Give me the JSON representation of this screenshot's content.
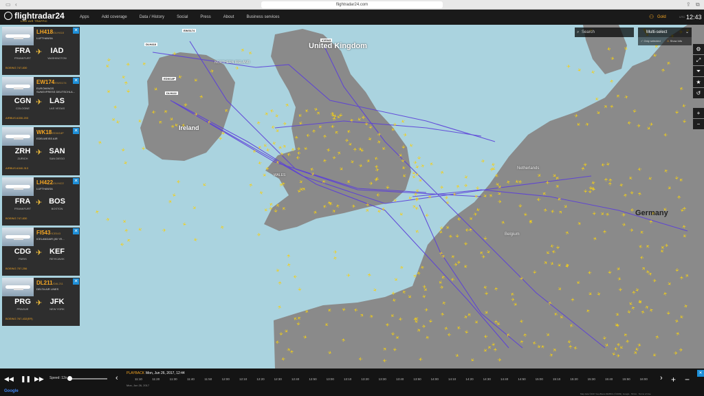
{
  "browser": {
    "url": "flightradar24.com"
  },
  "nav": {
    "logo": "flightradar24",
    "logo_sub": "LIVE AIR TRAFFIC",
    "items": [
      "Apps",
      "Add coverage",
      "Data / History",
      "Social",
      "Press",
      "About",
      "Business services"
    ],
    "account": "Gold",
    "utc_label": "UTC",
    "clock": "12:43"
  },
  "map": {
    "countries": [
      "United Kingdom",
      "Ireland",
      "Germany"
    ],
    "regions": [
      "NORTHERN IRELAND",
      "WALES",
      "Netherlands",
      "Belgium"
    ],
    "flight_tags": [
      "EWG174",
      "DLH418",
      "ICE543",
      "EDW18P",
      "DLH422"
    ],
    "colors": {
      "sea": "#aad3df",
      "land": "#8a8a8a",
      "aircraft": "#f5d015",
      "route": "#5b3fd9"
    }
  },
  "search": {
    "placeholder": "Search",
    "multiselect": "Multi-select",
    "only_selected": "Only selected",
    "show_info": "Show info"
  },
  "side_controls": [
    "settings-icon",
    "fullscreen-icon",
    "filter-icon",
    "star-icon",
    "history-icon",
    "zoom-in",
    "zoom-out"
  ],
  "flights": [
    {
      "flight": "LH418",
      "callsign": "/DLH418",
      "airline": "LUFTHANSA",
      "from": "FRA",
      "from_city": "FRANKFURT",
      "to": "IAD",
      "to_city": "WASHINGTON",
      "aircraft": "BOEING 747-830"
    },
    {
      "flight": "EW174",
      "callsign": "/EWG174",
      "airline": "EUROWINGS",
      "airline2": "SUNEXPRESS DEUTSCHLA...",
      "from": "CGN",
      "from_city": "COLOGNE",
      "to": "LAS",
      "to_city": "LAS VEGAS",
      "aircraft": "AIRBUS A330-203"
    },
    {
      "flight": "WK18",
      "callsign": "/EDW18P",
      "airline": "EDELWEISS AIR",
      "from": "ZRH",
      "from_city": "ZURICH",
      "to": "SAN",
      "to_city": "SAN DIEGO",
      "aircraft": "AIRBUS A340-313"
    },
    {
      "flight": "LH422",
      "callsign": "/DLH422",
      "airline": "LUFTHANSA",
      "from": "FRA",
      "from_city": "FRANKFURT",
      "to": "BOS",
      "to_city": "BOSTON",
      "aircraft": "BOEING 747-830"
    },
    {
      "flight": "FI543",
      "callsign": "/ICE543",
      "airline": "ICELANDAIR (80 YE...",
      "from": "CDG",
      "from_city": "PARIS",
      "to": "KEF",
      "to_city": "REYKJAVIK",
      "aircraft": "BOEING 757-256"
    },
    {
      "flight": "DL211",
      "callsign": "/DAL211",
      "airline": "DELTA AIR LINES",
      "from": "PRG",
      "from_city": "PRAGUE",
      "to": "JFK",
      "to_city": "NEW YORK",
      "aircraft": "BOEING 767-432(ER)"
    }
  ],
  "playback": {
    "label": "PLAYBACK",
    "datetime": "Mon, Jun 26, 2017, 12:44",
    "date_small": "Mon, Jun 26, 2017",
    "speed_label": "Speed: 12x",
    "ticks": [
      "11:10",
      "11:20",
      "11:30",
      "11:40",
      "11:50",
      "12:00",
      "12:10",
      "12:20",
      "12:30",
      "12:40",
      "12:50",
      "13:00",
      "13:10",
      "13:20",
      "13:30",
      "13:40",
      "13:50",
      "14:00",
      "14:10",
      "14:20",
      "14:30",
      "14:40",
      "14:50",
      "15:00",
      "15:10",
      "15:20",
      "15:30",
      "15:40",
      "15:50",
      "16:00"
    ]
  },
  "footer": {
    "google": "Google",
    "attribution": "Map data ©2017 GeoBasis-DE/BKG (©2009), Google  ·  50 km  ·  Terms of Use"
  }
}
